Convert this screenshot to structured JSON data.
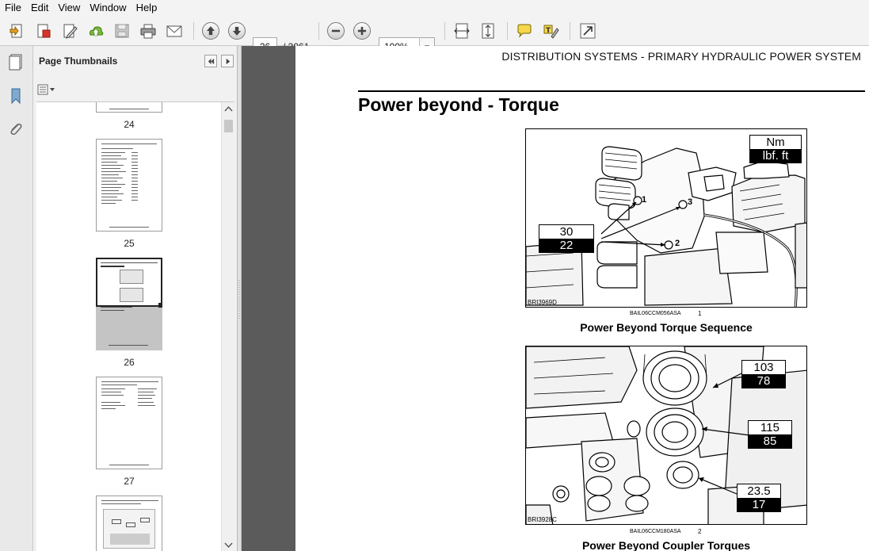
{
  "menu": [
    "File",
    "Edit",
    "View",
    "Window",
    "Help"
  ],
  "toolbar": {
    "icons": [
      "create-icon",
      "convert-icon",
      "edit-icon",
      "upload-icon",
      "save-icon",
      "print-icon",
      "email-icon",
      "previous-page-icon",
      "next-page-icon",
      "zoom-out-icon",
      "zoom-in-icon",
      "fit-width-icon",
      "fit-page-icon",
      "comment-icon",
      "highlight-icon",
      "expand-icon"
    ],
    "page_current": "26",
    "page_total": "/ 3061",
    "zoom": "100%"
  },
  "thumbnails": {
    "title": "Page Thumbnails",
    "pages": [
      {
        "number": "24",
        "selected": false
      },
      {
        "number": "25",
        "selected": false
      },
      {
        "number": "26",
        "selected": true
      },
      {
        "number": "27",
        "selected": false
      }
    ]
  },
  "document": {
    "running_head": "DISTRIBUTION SYSTEMS - PRIMARY HYDRAULIC POWER SYSTEM",
    "title": "Power beyond - Torque",
    "figures": [
      {
        "code": "BRI3969D",
        "ref": "BAIL06CCM056ASA",
        "number": "1",
        "caption": "Power Beyond Torque Sequence",
        "legend": {
          "top": "Nm",
          "bottom": "lbf. ft"
        },
        "torques": [
          {
            "nm": "30",
            "lbf": "22"
          }
        ],
        "callouts": [
          "1",
          "2",
          "3"
        ]
      },
      {
        "code": "BRI3928C",
        "ref": "BAIL06CCM180ASA",
        "number": "2",
        "caption": "Power Beyond Coupler Torques",
        "torques": [
          {
            "nm": "103",
            "lbf": "78"
          },
          {
            "nm": "115",
            "lbf": "85"
          },
          {
            "nm": "23.5",
            "lbf": "17"
          }
        ]
      }
    ]
  }
}
